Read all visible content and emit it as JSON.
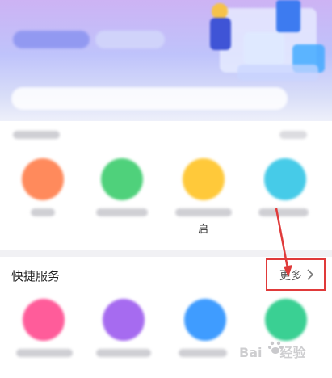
{
  "colors": {
    "accent_red": "#e03a3a",
    "app_orange": "#ff8a5c",
    "app_green": "#4fd17b",
    "app_yellow": "#ffc93a",
    "app_cyan": "#46cbe8",
    "app_pink": "#ff5c9a",
    "app_purple": "#a66bf0",
    "app_blue": "#3f9cff",
    "app_teal": "#3ad093"
  },
  "section1": {
    "partial_label": "启",
    "apps": [
      {
        "icon": "blurred-orange-app-icon"
      },
      {
        "icon": "blurred-green-app-icon"
      },
      {
        "icon": "blurred-yellow-app-icon"
      },
      {
        "icon": "blurred-cyan-app-icon"
      }
    ]
  },
  "quick_services": {
    "title": "快捷服务",
    "more_label": "更多",
    "apps": [
      {
        "icon": "blurred-pink-app-icon"
      },
      {
        "icon": "blurred-purple-app-icon"
      },
      {
        "icon": "blurred-blue-app-icon"
      },
      {
        "icon": "blurred-teal-app-icon"
      }
    ]
  },
  "watermark": {
    "text": "Bai",
    "text2": "经验"
  }
}
